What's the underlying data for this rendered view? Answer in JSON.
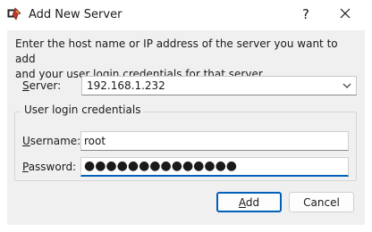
{
  "window": {
    "title": "Add New Server",
    "help_label": "?",
    "app_icon": "putty-app-icon",
    "close_icon": "close-icon"
  },
  "description": "Enter the host name or IP address of the server you want to add\nand your user login credentials for that server.",
  "server": {
    "label_mnemonic": "S",
    "label_rest": "erver:",
    "value": "192.168.1.232",
    "dropdown_icon": "chevron-down-icon"
  },
  "credentials": {
    "group_title": "User login credentials",
    "username": {
      "label_mnemonic": "U",
      "label_rest": "sername:",
      "value": "root"
    },
    "password": {
      "label_mnemonic": "P",
      "label_rest": "assword:",
      "value": "●●●●●●●●●●●●●●"
    }
  },
  "buttons": {
    "add_mnemonic": "A",
    "add_rest": "dd",
    "cancel_label": "Cancel"
  },
  "colors": {
    "accent": "#005fb8",
    "client_bg": "#f0f0f0"
  }
}
